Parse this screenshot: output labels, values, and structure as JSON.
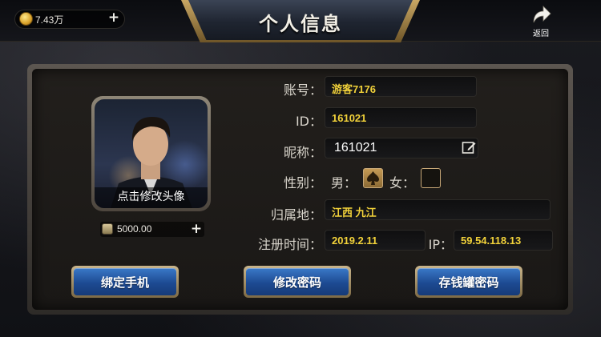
{
  "header": {
    "title": "个人信息",
    "coins": "7.43万",
    "back_label": "返回"
  },
  "profile": {
    "avatar_caption": "点击修改头像",
    "balance": "5000.00",
    "fields": {
      "account_label": "账号：",
      "account_value": "游客7176",
      "id_label": "ID：",
      "id_value": "161021",
      "nickname_label": "昵称：",
      "nickname_value": "161021",
      "gender_label": "性别：",
      "male_label": "男：",
      "female_label": "女：",
      "gender_selected": "male",
      "region_label": "归属地：",
      "region_value": "江西 九江",
      "register_label": "注册时间：",
      "register_value": "2019.2.11",
      "ip_label": "IP：",
      "ip_value": "59.54.118.13"
    }
  },
  "actions": {
    "bind_phone": "绑定手机",
    "change_password": "修改密码",
    "vault_password": "存钱罐密码"
  },
  "colors": {
    "value_gold": "#f2d23a",
    "button_blue": "#1d4a92",
    "frame_gold": "#c9a764"
  },
  "icons": [
    "coin-icon",
    "plus-icon",
    "back-arrow-icon",
    "edit-icon",
    "spade-icon",
    "balance-icon"
  ]
}
